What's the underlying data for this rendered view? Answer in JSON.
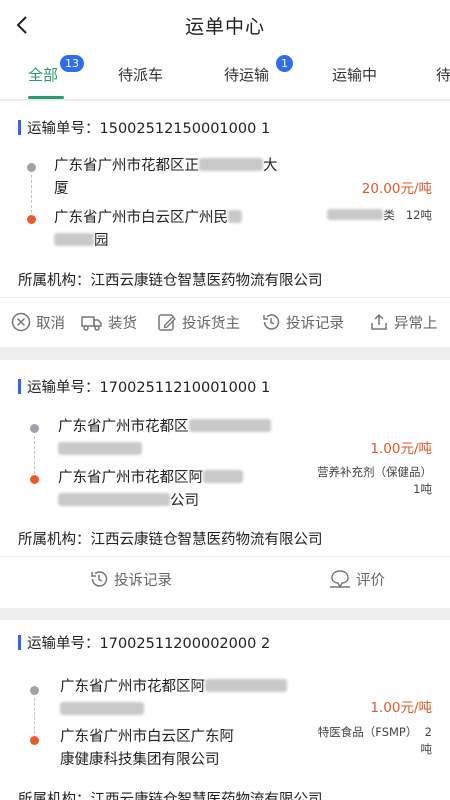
{
  "header": {
    "title": "运单中心",
    "back_icon": "chevron-left-icon"
  },
  "tabs": [
    {
      "label": "全部",
      "badge": "13",
      "active": true
    },
    {
      "label": "待派车",
      "badge": "",
      "active": false
    },
    {
      "label": "待运输",
      "badge": "1",
      "active": false
    },
    {
      "label": "运输中",
      "badge": "",
      "active": false
    },
    {
      "label": "待",
      "badge": "",
      "active": false
    }
  ],
  "colors": {
    "accent": "#2a9a6c",
    "badge": "#2f6df0",
    "price": "#e2572b",
    "head_bar": "#3167e6"
  },
  "orders": [
    {
      "number_label": "运输单号：",
      "number": "15002512150001000 1",
      "from_line1": "广东省广州市花都区正",
      "from_line1_tail": "大",
      "from_line2": "厦",
      "to_line1": "广东省广州市白云区广州民",
      "to_line2": "园",
      "price": "20.00元/吨",
      "goods": "类",
      "weight": "12吨",
      "org_label": "所属机构：",
      "org_name": "江西云康链仓智慧医药物流有限公司",
      "actions": [
        {
          "label": "取消",
          "icon": "cancel-circle-icon"
        },
        {
          "label": "装货",
          "icon": "truck-icon"
        },
        {
          "label": "投诉货主",
          "icon": "edit-icon"
        },
        {
          "label": "投诉记录",
          "icon": "history-icon"
        },
        {
          "label": "异常上",
          "icon": "upload-icon"
        }
      ]
    },
    {
      "number_label": "运输单号：",
      "number": "17002511210001000 1",
      "from_line1": "广东省广州市花都区",
      "from_line2": "",
      "to_line1": "广东省广州市花都区阿",
      "to_line2": "公司",
      "price": "1.00元/吨",
      "goods": "营养补充剂（保健品）",
      "weight": "1吨",
      "org_label": "所属机构：",
      "org_name": "江西云康链仓智慧医药物流有限公司",
      "actions": [
        {
          "label": "投诉记录",
          "icon": "history-icon"
        },
        {
          "label": "评价",
          "icon": "review-icon"
        }
      ]
    },
    {
      "number_label": "运输单号：",
      "number": "17002511200002000 2",
      "from_line1": "广东省广州市花都区阿",
      "from_line2": "",
      "to_line1": "广东省广州市白云区广东阿",
      "to_line2": "康健康科技集团有限公司",
      "price": "1.00元/吨",
      "goods": "特医食品（FSMP）",
      "weight": "2",
      "weight2": "吨",
      "org_label": "所属机构：",
      "org_name": "江西云康链仓智慧医药物流有限公司"
    }
  ]
}
